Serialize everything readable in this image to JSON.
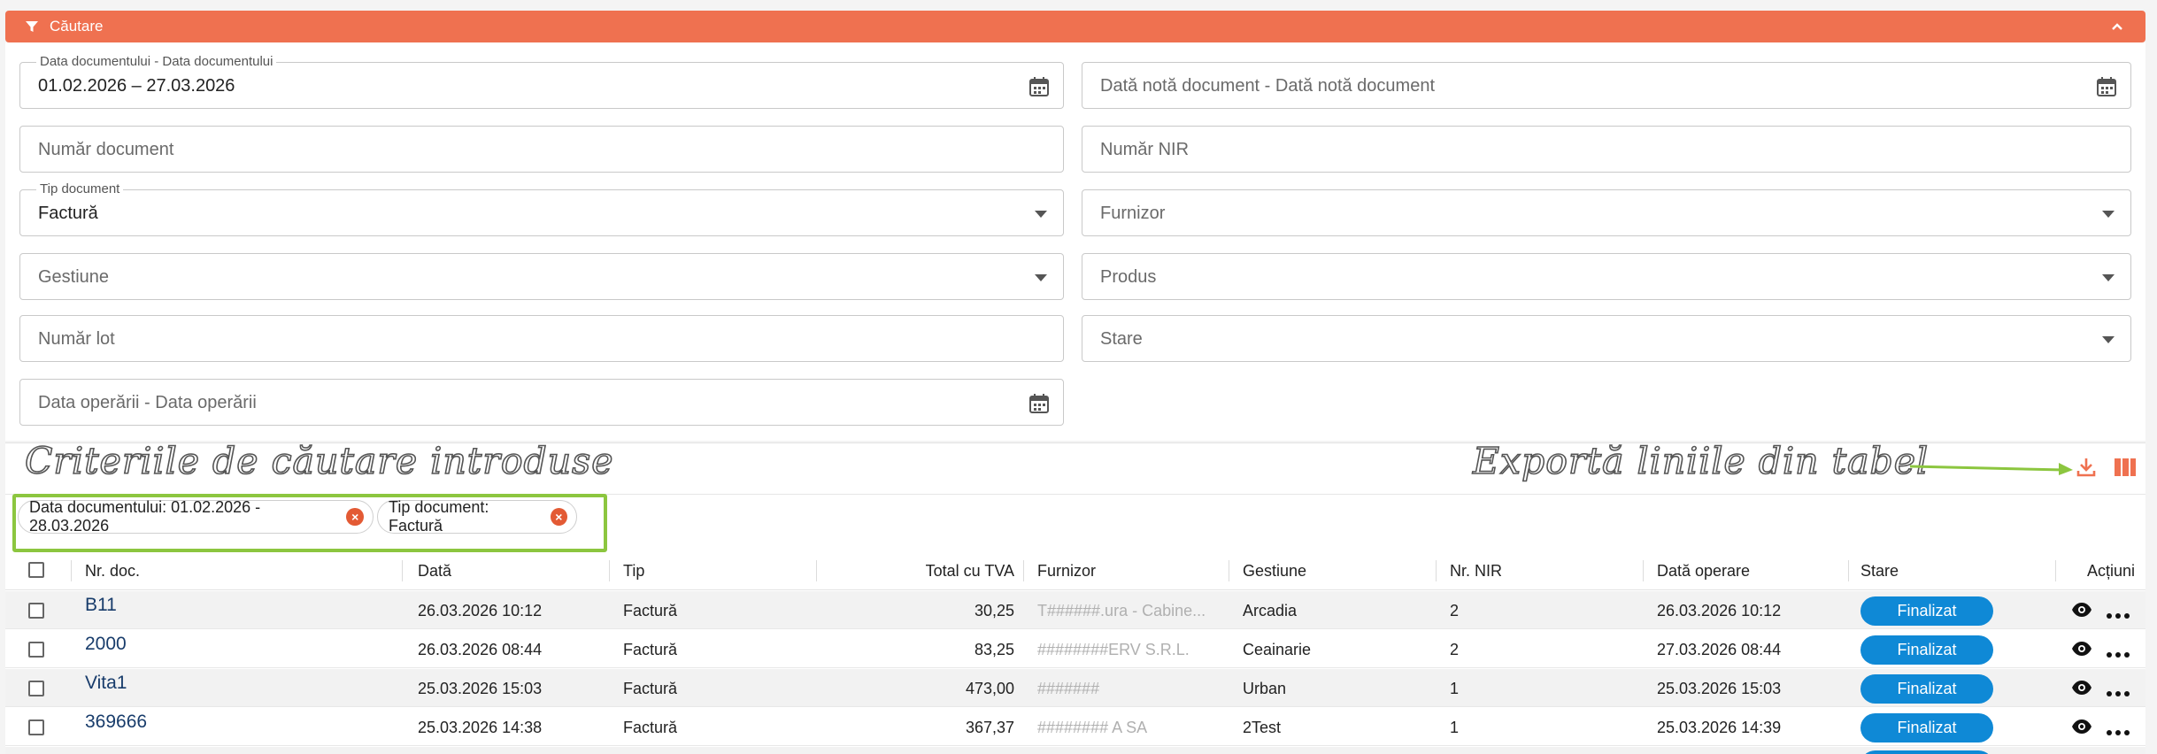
{
  "search": {
    "title": "Căutare",
    "fields": {
      "date_range": {
        "label": "Data documentului - Data documentului",
        "value": "01.02.2026 – 27.03.2026"
      },
      "note_date": {
        "placeholder": "Dată notă document - Dată notă document"
      },
      "doc_number": {
        "placeholder": "Număr document"
      },
      "nir_number": {
        "placeholder": "Număr NIR"
      },
      "doc_type": {
        "label": "Tip document",
        "value": "Factură"
      },
      "supplier": {
        "placeholder": "Furnizor"
      },
      "management": {
        "placeholder": "Gestiune"
      },
      "product": {
        "placeholder": "Produs"
      },
      "lot_number": {
        "placeholder": "Număr lot"
      },
      "status": {
        "placeholder": "Stare"
      },
      "operation_date": {
        "placeholder": "Data operării - Data operării"
      }
    }
  },
  "annotations": {
    "criteria": "Criteriile de căutare introduse",
    "export": "Exportă liniile din tabel"
  },
  "chips": [
    {
      "label": "Data documentului: 01.02.2026 - 28.03.2026"
    },
    {
      "label": "Tip document: Factură"
    }
  ],
  "table": {
    "headers": {
      "doc_no": "Nr. doc.",
      "date": "Dată",
      "type": "Tip",
      "total": "Total cu TVA",
      "supplier": "Furnizor",
      "management": "Gestiune",
      "nir": "Nr. NIR",
      "op_date": "Dată operare",
      "status": "Stare",
      "actions": "Acțiuni"
    },
    "rows": [
      {
        "doc_no": "B11",
        "date": "26.03.2026 10:12",
        "type": "Factură",
        "total": "30,25",
        "supplier": "T######.ura - Cabine...",
        "management": "Arcadia",
        "nir": "2",
        "op_date": "26.03.2026 10:12",
        "status": "Finalizat"
      },
      {
        "doc_no": "2000",
        "date": "26.03.2026 08:44",
        "type": "Factură",
        "total": "83,25",
        "supplier": "########ERV S.R.L.",
        "management": "Ceainarie",
        "nir": "2",
        "op_date": "27.03.2026 08:44",
        "status": "Finalizat"
      },
      {
        "doc_no": "Vita1",
        "date": "25.03.2026 15:03",
        "type": "Factură",
        "total": "473,00",
        "supplier": "#######",
        "management": "Urban",
        "nir": "1",
        "op_date": "25.03.2026 15:03",
        "status": "Finalizat"
      },
      {
        "doc_no": "369666",
        "date": "25.03.2026 14:38",
        "type": "Factură",
        "total": "367,37",
        "supplier": "######## A SA",
        "management": "2Test",
        "nir": "1",
        "op_date": "25.03.2026 14:39",
        "status": "Finalizat"
      }
    ]
  },
  "colors": {
    "accent": "#ef7150",
    "badge": "#0f89d6",
    "highlight": "#8cc63f",
    "link": "#183c6b"
  }
}
